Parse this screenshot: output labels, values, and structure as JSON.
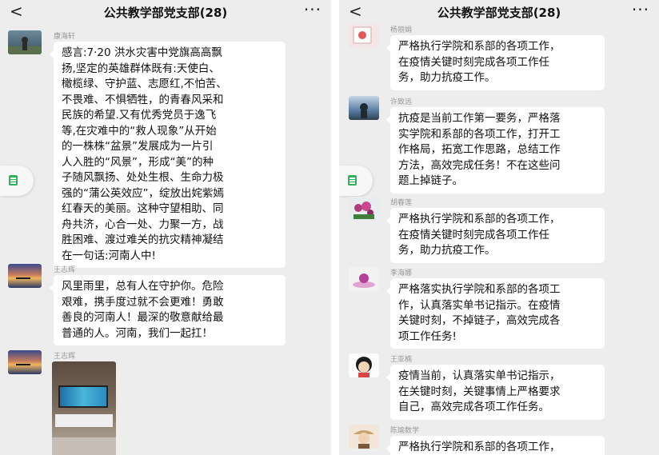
{
  "chat": {
    "title": "公共教学部党支部(28)",
    "back_icon": "chevron-left-icon",
    "more_icon": "ellipsis-icon",
    "back_glyph": "<",
    "more_glyph": "···"
  },
  "left_messages": [
    {
      "sender": "康海轩",
      "text": "感言:7·20 洪水灾害中党旗高高飘\n扬,坚定的英雄群体既有:天使白、\n橄榄绿、守护蓝、志愿红,不怕苦、\n不畏难、不惧牺牲，的青春风采和\n民族的希望.又有优秀党员于逸飞\n等,在灾难中的“救人现象”从开始\n的一株株“盆景”发展成为一片引\n人入胜的“风景”，形成“美”的种\n子随风飘扬、处处生根、生命力极\n强的“蒲公英效应”，绽放出姹紫嫣\n红春天的美丽。这种守望相助、同\n舟共济，心合一处、力聚一方，战\n胜困难、渡过难关的抗灾精神凝结\n在一句话:河南人中!"
    },
    {
      "sender": "王志辉",
      "text": "风里雨里，总有人在守护你。危险\n艰难，携手度过就不会更难！勇敢\n善良的河南人！最深的敬意献给最\n普通的人。河南，我们一起扛！"
    },
    {
      "sender": "王志辉",
      "text": ""
    }
  ],
  "right_messages": [
    {
      "sender": "杨丽娟",
      "text": "严格执行学院和系部的各项工作，\n在疫情关键时刻完成各项工作任\n务，助力抗疫工作。"
    },
    {
      "sender": "许致远",
      "text": "抗疫是当前工作第一要务，严格落\n实学院和系部的各项工作，打开工\n作格局，拓宽工作思路，总结工作\n方法，高效完成任务！不在这些问\n题上掉链子。"
    },
    {
      "sender": "胡春莲",
      "text": "严格执行学院和系部的各项工作，\n在疫情关键时刻完成各项工作任\n务，助力抗疫工作。"
    },
    {
      "sender": "李海娜",
      "text": "严格落实执行学院和系部的各项工\n作，认真落实单书记指示。在疫情\n关键时刻，不掉链子，高效完成各\n项工作任务!"
    },
    {
      "sender": "王亚楠",
      "text": "疫情当前，认真落实单书记指示，\n在关键时刻，关键事情上严格要求\n自己，高效完成各项工作任务。"
    },
    {
      "sender": "陈瑜数学",
      "text": "严格执行学院和系部的各项工作，"
    }
  ],
  "colors": {
    "background": "#ededed",
    "bubble": "#ffffff",
    "floating_icon": "#2fb05a"
  }
}
